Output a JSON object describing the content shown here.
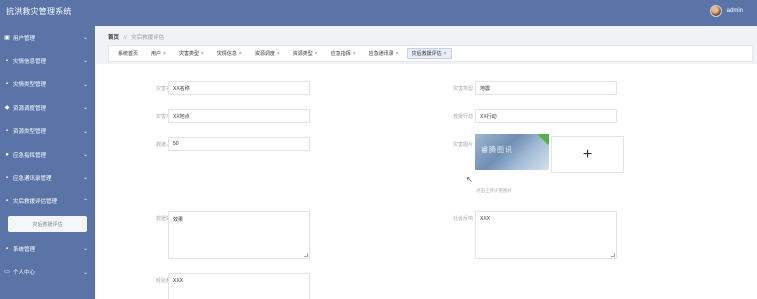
{
  "header": {
    "app_title": "抗洪救灾管理系统",
    "username": "admin"
  },
  "sidebar": {
    "items": [
      {
        "label": "用户管理",
        "icon": "user-group-icon"
      },
      {
        "label": "灾情信息管理",
        "icon": "grid-icon"
      },
      {
        "label": "灾情类型管理",
        "icon": "grid-icon"
      },
      {
        "label": "资源调度管理",
        "icon": "truck-icon"
      },
      {
        "label": "资源类型管理",
        "icon": "grid-icon"
      },
      {
        "label": "应急指挥管理",
        "icon": "person-icon"
      },
      {
        "label": "应急通讯录管理",
        "icon": "grid-icon"
      },
      {
        "label": "灾后救援评估管理",
        "icon": "grid-icon"
      }
    ],
    "active_submenu": "灾后救援评估",
    "items_after": [
      {
        "label": "系统管理",
        "icon": "grid-icon"
      },
      {
        "label": "个人中心",
        "icon": "monitor-icon"
      }
    ]
  },
  "breadcrumb": {
    "home": "首页",
    "separator": "//",
    "current": "灾后救援评估"
  },
  "tabs": [
    {
      "label": "系统首页",
      "closable": false
    },
    {
      "label": "用户",
      "closable": true
    },
    {
      "label": "灾害类型",
      "closable": true
    },
    {
      "label": "灾情信息",
      "closable": true
    },
    {
      "label": "资源调度",
      "closable": true
    },
    {
      "label": "资源类型",
      "closable": true
    },
    {
      "label": "应急指挥",
      "closable": true
    },
    {
      "label": "应急通讯录",
      "closable": true
    },
    {
      "label": "灾后救援评估",
      "closable": true,
      "active": true
    }
  ],
  "tab_close_glyph": "×",
  "form": {
    "disaster_name": {
      "label": "灾害名称",
      "value": "XX名称"
    },
    "disaster_type": {
      "label": "灾害类型",
      "value": "地震"
    },
    "disaster_location": {
      "label": "灾害地点",
      "value": "XX地点"
    },
    "rescue_action": {
      "label": "救援行动",
      "value": "XX行动"
    },
    "rescue_count": {
      "label": "救援人数",
      "value": "50"
    },
    "disaster_image": {
      "label": "灾害图片",
      "upload_plus": "+",
      "hint": "点击上传灾害图片",
      "watermark": "睿腾图讯"
    },
    "rescue_effect": {
      "label": "救援效果",
      "value": "效果"
    },
    "experience_summary": {
      "label": "经验教训",
      "value": "XXX"
    },
    "social_feedback": {
      "label": "社会反响",
      "value": "XXX"
    }
  },
  "colors": {
    "primary": "#5b74a8",
    "active_tab_bg": "#e8edf6"
  }
}
